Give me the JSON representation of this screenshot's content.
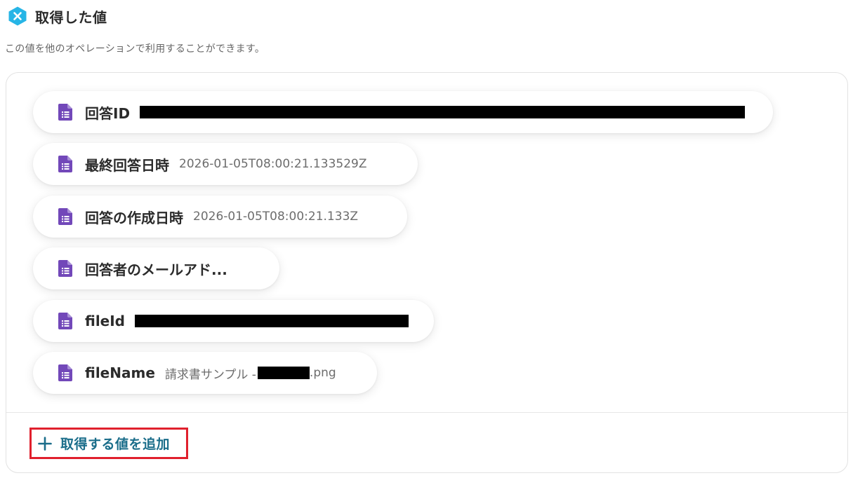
{
  "header": {
    "title": "取得した値",
    "icon": "yoom-logo-icon",
    "icon_color": "#27b5e6"
  },
  "description": "この値を他のオペレーションで利用することができます。",
  "items": [
    {
      "label": "回答ID",
      "value": "",
      "redacted": true,
      "icon": "google-forms-icon"
    },
    {
      "label": "最終回答日時",
      "value": "2026-01-05T08:00:21.133529Z",
      "icon": "google-forms-icon"
    },
    {
      "label": "回答の作成日時",
      "value": "2026-01-05T08:00:21.133Z",
      "icon": "google-forms-icon"
    },
    {
      "label": "回答者のメールアド...",
      "value": "",
      "icon": "google-forms-icon"
    },
    {
      "label": "fileId",
      "value": "",
      "redacted": true,
      "icon": "google-forms-icon"
    },
    {
      "label": "fileName",
      "value_prefix": "請求書サンプル - ",
      "value_suffix": ".png",
      "icon": "google-forms-icon"
    }
  ],
  "add_button": {
    "label": "取得する値を追加",
    "icon": "plus-icon",
    "color": "#1a6d8a",
    "highlight_color": "#e0202d"
  },
  "colors": {
    "forms_purple": "#7248b9"
  }
}
